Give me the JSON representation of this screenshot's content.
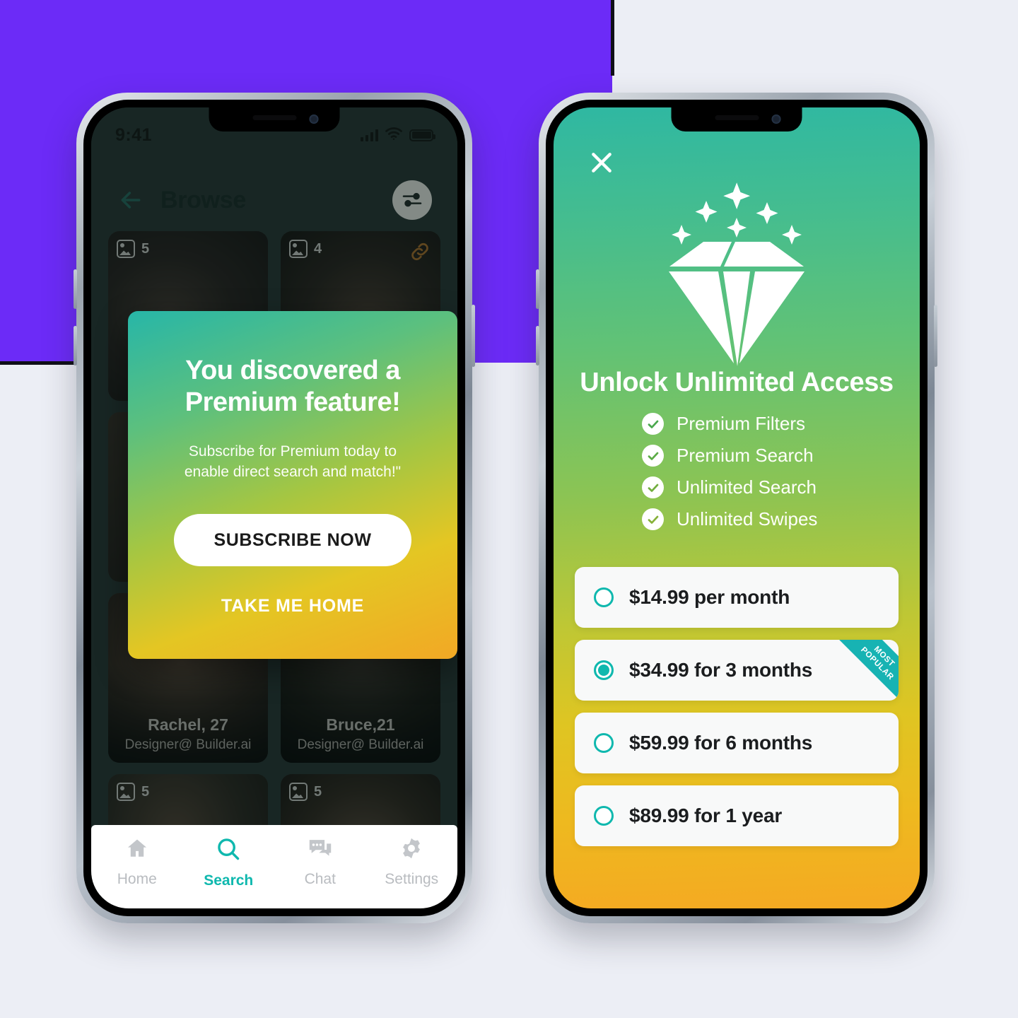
{
  "background": {
    "purple_block_color": "#6c2bf7",
    "page_color": "#eceef5",
    "line_color": "#101018"
  },
  "left_phone": {
    "status_bar": {
      "time": "9:41",
      "signal_icon": "cellular-signal-icon",
      "wifi_icon": "wifi-icon",
      "battery_icon": "battery-full-icon"
    },
    "header": {
      "back_icon": "back-arrow-icon",
      "title": "Browse",
      "filter_icon": "filter-sliders-icon"
    },
    "cards": [
      {
        "photo_count": "5",
        "name": "",
        "role": "",
        "has_link_icon": false
      },
      {
        "photo_count": "4",
        "name": "",
        "role": "",
        "has_link_icon": true
      },
      {
        "photo_count": "",
        "name": "",
        "role": "",
        "has_link_icon": false
      },
      {
        "photo_count": "",
        "name": "",
        "role": "",
        "has_link_icon": false
      },
      {
        "photo_count": "",
        "name": "Rachel, 27",
        "role": "Designer@ Builder.ai",
        "has_link_icon": false
      },
      {
        "photo_count": "",
        "name": "Bruce,21",
        "role": "Designer@ Builder.ai",
        "has_link_icon": false
      },
      {
        "photo_count": "5",
        "name": "",
        "role": "",
        "has_link_icon": false
      },
      {
        "photo_count": "5",
        "name": "",
        "role": "",
        "has_link_icon": false
      }
    ],
    "modal": {
      "title_line1": "You discovered a",
      "title_line2": "Premium feature!",
      "subtitle_line1": "Subscribe for Premium today to",
      "subtitle_line2": "enable direct search and match!\"",
      "primary_button": "SUBSCRIBE NOW",
      "secondary_button": "TAKE ME HOME"
    },
    "tabbar": {
      "active_color": "#0fb8ae",
      "inactive_color": "#b9bcc0",
      "tabs": [
        {
          "label": "Home",
          "icon": "home-icon",
          "active": false
        },
        {
          "label": "Search",
          "icon": "search-icon",
          "active": true
        },
        {
          "label": "Chat",
          "icon": "chat-icon",
          "active": false
        },
        {
          "label": "Settings",
          "icon": "gear-icon",
          "active": false
        }
      ]
    }
  },
  "right_phone": {
    "close_icon": "close-x-icon",
    "hero_icon": "diamond-sparkle-icon",
    "title": "Unlock Unlimited Access",
    "features": [
      {
        "label": "Premium Filters",
        "icon": "check-circle-icon"
      },
      {
        "label": "Premium Search",
        "icon": "check-circle-icon"
      },
      {
        "label": "Unlimited Search",
        "icon": "check-circle-icon"
      },
      {
        "label": "Unlimited Swipes",
        "icon": "check-circle-icon"
      }
    ],
    "plans": [
      {
        "label": "$14.99 per month",
        "selected": false,
        "ribbon": ""
      },
      {
        "label": "$34.99 for 3 months",
        "selected": true,
        "ribbon_line1": "MOST",
        "ribbon_line2": "POPULAR"
      },
      {
        "label": "$59.99 for 6 months",
        "selected": false,
        "ribbon": ""
      },
      {
        "label": "$89.99 for 1 year",
        "selected": false,
        "ribbon": ""
      }
    ],
    "accent_color": "#0fb8ae",
    "ribbon_color": "#17b3b3"
  }
}
